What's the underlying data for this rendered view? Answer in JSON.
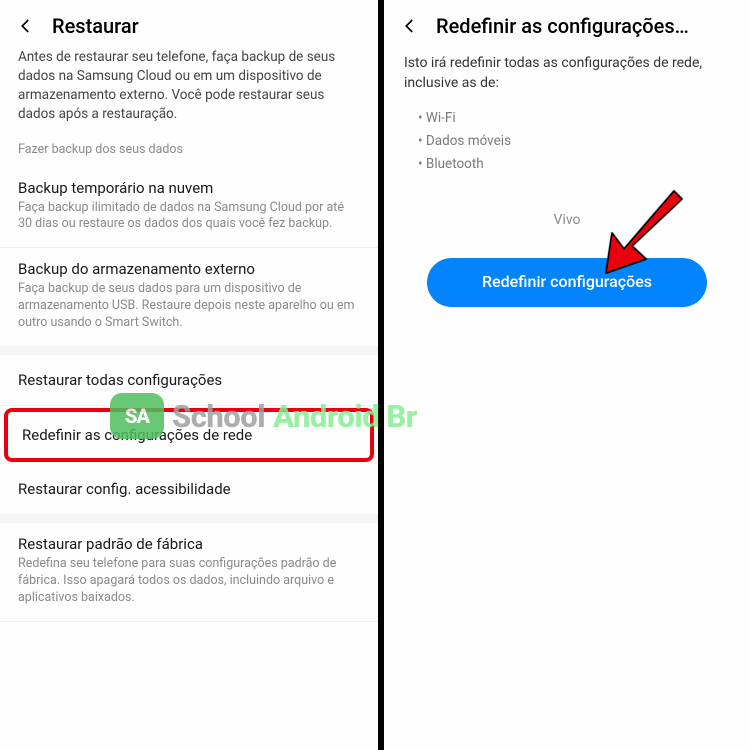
{
  "left": {
    "title": "Restaurar",
    "intro": "Antes de restaurar seu telefone, faça backup de seus dados na Samsung Cloud ou em um dispositivo de armazenamento externo. Você pode restaurar seus dados após a restauração.",
    "section_label": "Fazer backup dos seus dados",
    "items": {
      "cloud": {
        "title": "Backup temporário na nuvem",
        "desc": "Faça backup ilimitado de dados na Samsung Cloud por até 30 dias ou restaure os dados dos quais você fez backup."
      },
      "external": {
        "title": "Backup do armazenamento externo",
        "desc": "Faça backup de seus dados para um dispositivo de armazenamento USB. Restaure depois neste aparelho ou em outro usando o Smart Switch."
      },
      "restore_all": {
        "title": "Restaurar todas configurações"
      },
      "reset_network": {
        "title": "Redefinir as configurações de rede"
      },
      "accessibility": {
        "title": "Restaurar config. acessibilidade"
      },
      "factory": {
        "title": "Restaurar padrão de fábrica",
        "desc": "Redefina seu telefone para suas configurações padrão de fábrica. Isso apagará todos os dados, incluindo arquivo e aplicativos baixados."
      }
    }
  },
  "right": {
    "title": "Redefinir as configurações…",
    "intro": "Isto irá redefinir todas as configurações de rede, inclusive as de:",
    "bullets": {
      "wifi": "• Wi-Fi",
      "mobile": "• Dados móveis",
      "bluetooth": "• Bluetooth"
    },
    "carrier": "Vivo",
    "cta": "Redefinir configurações"
  },
  "watermark": {
    "text1": "School",
    "text2": "Android Br"
  }
}
